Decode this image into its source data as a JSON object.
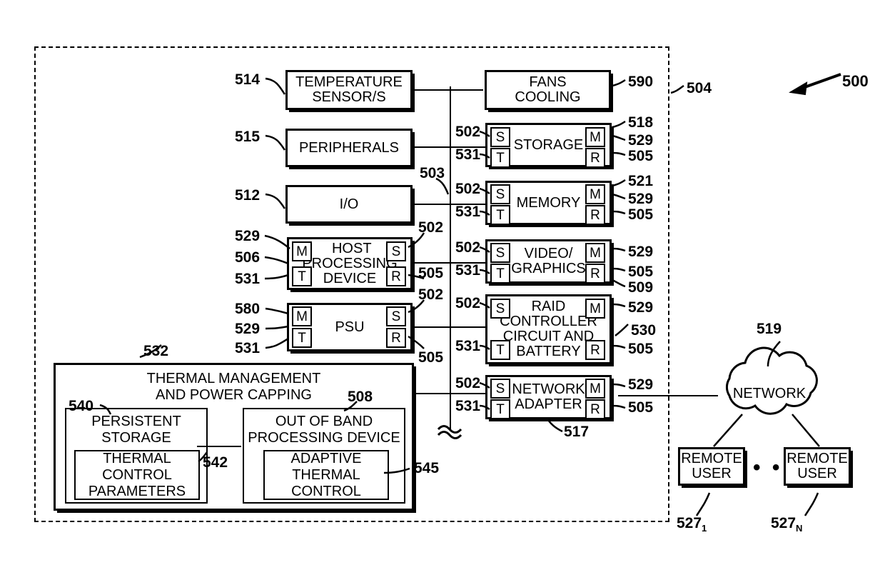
{
  "figure": {
    "number": "500",
    "enclosure_ref": "504",
    "bus_ref": "503",
    "break_symbol": "wavy-break"
  },
  "left_column": [
    {
      "id": "temperature-sensors",
      "label": "TEMPERATURE\nSENSOR/S",
      "ref_left": "514"
    },
    {
      "id": "peripherals",
      "label": "PERIPHERALS",
      "ref_left": "515"
    },
    {
      "id": "io",
      "label": "I/O",
      "ref_left": "512"
    },
    {
      "id": "host-processing-device",
      "label": "HOST\nPROCESSING\nDEVICE",
      "refs_left": [
        "529",
        "506",
        "531"
      ],
      "refs_right": [
        "502",
        "505"
      ],
      "tiles": {
        "tl": "M",
        "tr": "S",
        "bl": "T",
        "br": "R"
      }
    },
    {
      "id": "psu",
      "label": "PSU",
      "refs_left": [
        "580",
        "529",
        "531"
      ],
      "refs_right": [
        "502",
        "505"
      ],
      "tiles": {
        "tl": "M",
        "tr": "S",
        "bl": "T",
        "br": "R"
      }
    }
  ],
  "right_column": [
    {
      "id": "fans-cooling",
      "label": "FANS\nCOOLING",
      "ref_right": "590"
    },
    {
      "id": "storage",
      "label": "STORAGE",
      "refs_left": [
        "502",
        "531"
      ],
      "refs_right": [
        "518",
        "529",
        "505"
      ],
      "tiles": {
        "tl": "S",
        "tr": "M",
        "bl": "T",
        "br": "R"
      }
    },
    {
      "id": "memory",
      "label": "MEMORY",
      "refs_left": [
        "502",
        "531"
      ],
      "refs_right": [
        "521",
        "529",
        "505"
      ],
      "tiles": {
        "tl": "S",
        "tr": "M",
        "bl": "T",
        "br": "R"
      }
    },
    {
      "id": "video-graphics",
      "label": "VIDEO/\nGRAPHICS",
      "refs_left": [
        "502",
        "531"
      ],
      "refs_right": [
        "529",
        "505",
        "509"
      ],
      "tiles": {
        "tl": "S",
        "tr": "M",
        "bl": "T",
        "br": "R"
      }
    },
    {
      "id": "raid-controller",
      "label": "RAID\nCONTROLLER\nCIRCUIT AND\nBATTERY",
      "refs_left": [
        "502",
        "531"
      ],
      "refs_right": [
        "529",
        "530",
        "505"
      ],
      "tiles": {
        "tl": "S",
        "tr": "M",
        "bl": "T",
        "br": "R"
      }
    },
    {
      "id": "network-adapter",
      "label": "NETWORK\nADAPTER",
      "refs_left": [
        "502",
        "531"
      ],
      "refs_right": [
        "529",
        "505"
      ],
      "ref_bottom": "517",
      "tiles": {
        "tl": "S",
        "tr": "M",
        "bl": "T",
        "br": "R"
      }
    }
  ],
  "thermal_block": {
    "ref": "532",
    "title": "THERMAL MANAGEMENT\nAND POWER CAPPING",
    "title_line1": "THERMAL MANAGEMENT",
    "title_line2": "AND POWER CAPPING",
    "persistent_storage": {
      "ref": "540",
      "title_line1": "PERSISTENT",
      "title_line2": "STORAGE",
      "child": {
        "ref": "542",
        "line1": "THERMAL",
        "line2": "CONTROL",
        "line3": "PARAMETERS"
      }
    },
    "oob": {
      "ref": "508",
      "title_line1": "OUT OF BAND",
      "title_line2": "PROCESSING DEVICE",
      "child": {
        "ref": "545",
        "line1": "ADAPTIVE",
        "line2": "THERMAL",
        "line3": "CONTROL"
      }
    }
  },
  "network": {
    "label": "NETWORK",
    "ref": "519",
    "remote_users": [
      {
        "label_line1": "REMOTE",
        "label_line2": "USER",
        "ref_num": "527",
        "ref_sub": "1"
      },
      {
        "label_line1": "REMOTE",
        "label_line2": "USER",
        "ref_num": "527",
        "ref_sub": "N"
      }
    ],
    "ellipsis": "• • •"
  },
  "tile_glyphs": {
    "S": "S",
    "M": "M",
    "T": "T",
    "R": "R"
  },
  "colors": {
    "stroke": "#000000",
    "background": "#ffffff"
  }
}
